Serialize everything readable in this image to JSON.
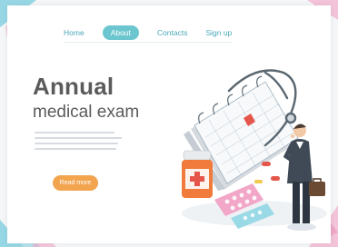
{
  "nav": {
    "items": [
      {
        "label": "Home"
      },
      {
        "label": "About",
        "active": true
      },
      {
        "label": "Contacts"
      },
      {
        "label": "Sign up"
      }
    ]
  },
  "hero": {
    "title_line1": "Annual",
    "title_line2": "medical exam",
    "cta_label": "Read more"
  },
  "colors": {
    "accent": "#6cc6cf",
    "cta": "#f2a44f",
    "title": "#5b5b5b"
  },
  "illustration": {
    "icons": [
      "calendar-icon",
      "stethoscope-icon",
      "pill-bottle-icon",
      "pill-blister-icon",
      "doctor-figure",
      "briefcase-icon"
    ]
  }
}
